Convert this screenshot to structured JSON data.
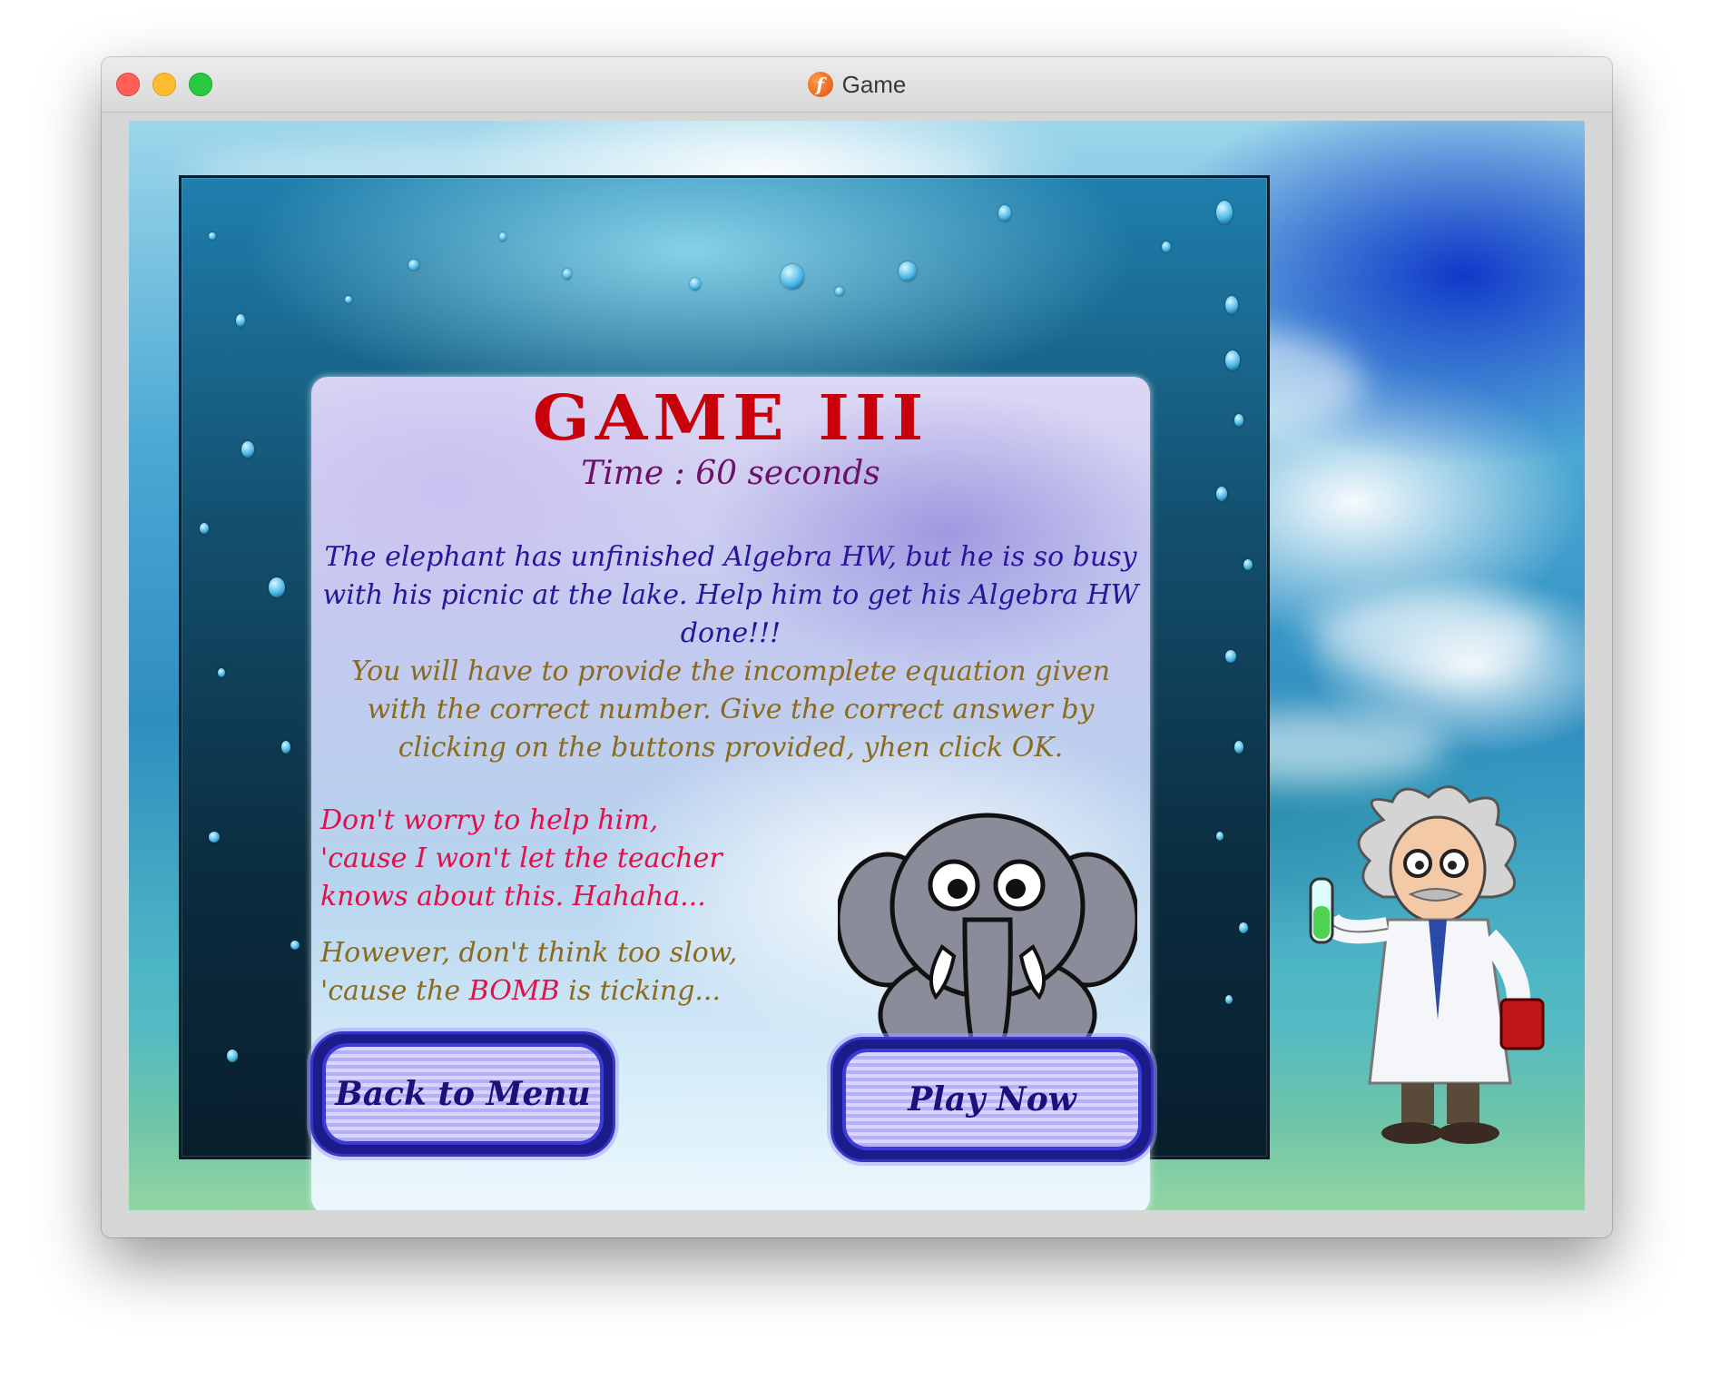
{
  "window": {
    "title": "Game",
    "app_icon": "flash-player-icon"
  },
  "card": {
    "heading": "GAME III",
    "time": "Time : 60 seconds",
    "story": "The elephant has unfinished Algebra HW, but he is so busy with his picnic at the lake. Help him to get his Algebra HW done!!!",
    "instructions": "You will have to provide the incomplete equation given with the correct number. Give the correct answer by clicking on the buttons provided, yhen click OK.",
    "reassure_line1": "Don't worry to help him,",
    "reassure_line2": "'cause I won't let the teacher",
    "reassure_line3": "knows about this. Hahaha...",
    "warning_line1": "However, don't think too slow,",
    "warning_line2_start": "'cause the ",
    "warning_bomb": "BOMB",
    "warning_line2_end": " is ticking..."
  },
  "buttons": {
    "back": "Back to Menu",
    "play": "Play Now"
  },
  "colors": {
    "title_red": "#c8000a",
    "story_blue": "#25169a",
    "instructions_gold": "#8a6a1e",
    "warning_red": "#e0104a",
    "button_blue": "#1c1b8a"
  }
}
